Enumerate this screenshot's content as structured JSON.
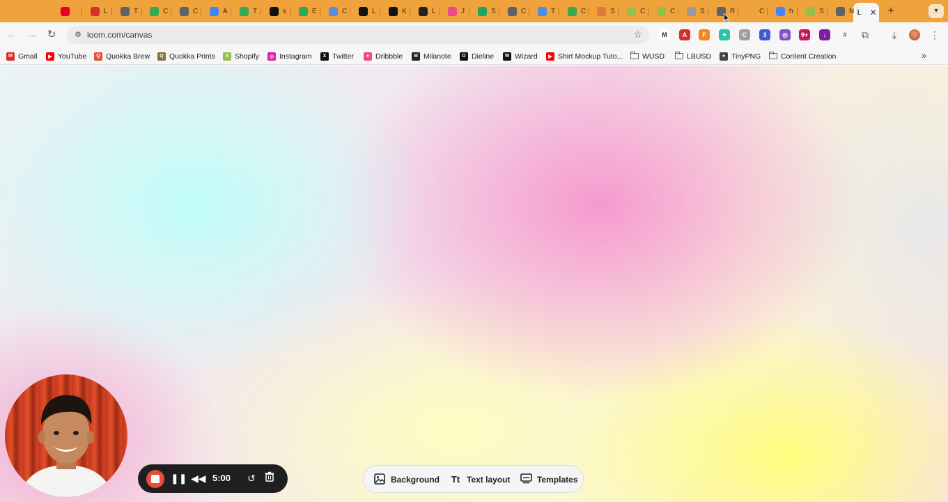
{
  "browser": {
    "tabs": [
      {
        "letter": "",
        "icon": "pinterest-icon",
        "color": "#e60023"
      },
      {
        "letter": "L",
        "icon": "gmail-icon",
        "color": "#d93025"
      },
      {
        "letter": "T",
        "icon": "tab-icon",
        "color": "#5f6368"
      },
      {
        "letter": "C",
        "icon": "sheets-plus-icon",
        "color": "#34a853"
      },
      {
        "letter": "C",
        "icon": "calendar-icon",
        "color": "#5f6368"
      },
      {
        "letter": "A",
        "icon": "app-icon",
        "color": "#4285f4"
      },
      {
        "letter": "T",
        "icon": "sheets-plus-icon",
        "color": "#34a853"
      },
      {
        "letter": "s",
        "icon": "video-icon",
        "color": "#111111"
      },
      {
        "letter": "E",
        "icon": "b-icon",
        "color": "#2eaa5e"
      },
      {
        "letter": "C",
        "icon": "pen-icon",
        "color": "#5b8ce0"
      },
      {
        "letter": "L",
        "icon": "app-icon",
        "color": "#111111"
      },
      {
        "letter": "K",
        "icon": "video-icon",
        "color": "#111111"
      },
      {
        "letter": "L",
        "icon": "m-icon",
        "color": "#222222"
      },
      {
        "letter": "J",
        "icon": "dribbble-icon",
        "color": "#ea4c89"
      },
      {
        "letter": "S",
        "icon": "drive-icon",
        "color": "#1fa463"
      },
      {
        "letter": "C",
        "icon": "globe-icon",
        "color": "#5f6368"
      },
      {
        "letter": "T",
        "icon": "globe-icon",
        "color": "#4a8ee8"
      },
      {
        "letter": "C",
        "icon": "sheets-plus-icon",
        "color": "#34a853"
      },
      {
        "letter": "S",
        "icon": "globe-icon",
        "color": "#e07a3a"
      },
      {
        "letter": "C",
        "icon": "shopify-icon",
        "color": "#95bf47"
      },
      {
        "letter": "C",
        "icon": "shopify-icon",
        "color": "#95bf47"
      },
      {
        "letter": "S",
        "icon": "globe-icon",
        "color": "#9a9a9a"
      },
      {
        "letter": "R",
        "icon": "gear-icon",
        "color": "#5f6368"
      },
      {
        "letter": "C",
        "icon": "blank-icon",
        "color": "#f0a23c"
      },
      {
        "letter": "h",
        "icon": "google-icon",
        "color": "#4285f4"
      },
      {
        "letter": "S",
        "icon": "shopify-icon",
        "color": "#95bf47"
      },
      {
        "letter": "N",
        "icon": "gear-icon",
        "color": "#5f6368"
      }
    ],
    "active_tab": {
      "letter": "L",
      "close": "✕"
    },
    "new_tab": "+",
    "url": "loom.com/canvas",
    "extensions": [
      {
        "letter": "M",
        "color": "#ffffff",
        "fg": "#222222"
      },
      {
        "letter": "A",
        "color": "#d32f2f",
        "fg": "#ffffff"
      },
      {
        "letter": "F",
        "color": "#f6851b",
        "fg": "#ffffff"
      },
      {
        "letter": "✦",
        "color": "#26c6a6",
        "fg": "#ffffff"
      },
      {
        "letter": "C",
        "color": "#9aa0a6",
        "fg": "#ffffff"
      },
      {
        "letter": "3",
        "color": "#3b5bdb",
        "fg": "#ffffff"
      },
      {
        "letter": "◎",
        "color": "#7e57c2",
        "fg": "#ffffff"
      },
      {
        "letter": "9+",
        "color": "#c2185b",
        "fg": "#ffffff"
      },
      {
        "letter": "↓",
        "color": "#7b1fa2",
        "fg": "#ffffff"
      },
      {
        "letter": "#",
        "color": "#f6f6f6",
        "fg": "#3f51b5"
      }
    ]
  },
  "bookmarks": [
    {
      "label": "Gmail",
      "icon": "gmail-icon",
      "color": "#d93025",
      "glyph": "M"
    },
    {
      "label": "YouTube",
      "icon": "youtube-icon",
      "color": "#ff0000",
      "glyph": "▶"
    },
    {
      "label": "Quokka Brew",
      "icon": "quokka-icon",
      "color": "#e0533a",
      "glyph": "Q"
    },
    {
      "label": "Quokka Prints",
      "icon": "quokka-icon",
      "color": "#8a6d3b",
      "glyph": "Q"
    },
    {
      "label": "Shopify",
      "icon": "shopify-icon",
      "color": "#95bf47",
      "glyph": "S"
    },
    {
      "label": "Instagram",
      "icon": "instagram-icon",
      "color": "#d6249f",
      "glyph": "◎"
    },
    {
      "label": "Twitter",
      "icon": "x-icon",
      "color": "#111111",
      "glyph": "X"
    },
    {
      "label": "Dribbble",
      "icon": "dribbble-icon",
      "color": "#ea4c89",
      "glyph": "●"
    },
    {
      "label": "Milanote",
      "icon": "milanote-icon",
      "color": "#222222",
      "glyph": "M"
    },
    {
      "label": "Dieline",
      "icon": "dieline-icon",
      "color": "#111111",
      "glyph": "D"
    },
    {
      "label": "Wizard",
      "icon": "wizard-icon",
      "color": "#111111",
      "glyph": "W"
    },
    {
      "label": "Shirt Mockup Tuto...",
      "icon": "youtube-icon",
      "color": "#ff0000",
      "glyph": "▶"
    },
    {
      "label": "WUSD",
      "icon": "folder-icon",
      "color": "",
      "glyph": ""
    },
    {
      "label": "LBUSD",
      "icon": "folder-icon",
      "color": "",
      "glyph": ""
    },
    {
      "label": "TinyPNG",
      "icon": "panda-icon",
      "color": "#444444",
      "glyph": "●"
    },
    {
      "label": "Content Creation",
      "icon": "folder-icon",
      "color": "",
      "glyph": ""
    }
  ],
  "recorder": {
    "timer": "5:00",
    "accent": "#e84c3d"
  },
  "canvas_options": {
    "background": "Background",
    "text_layout": "Text layout",
    "templates": "Templates"
  }
}
